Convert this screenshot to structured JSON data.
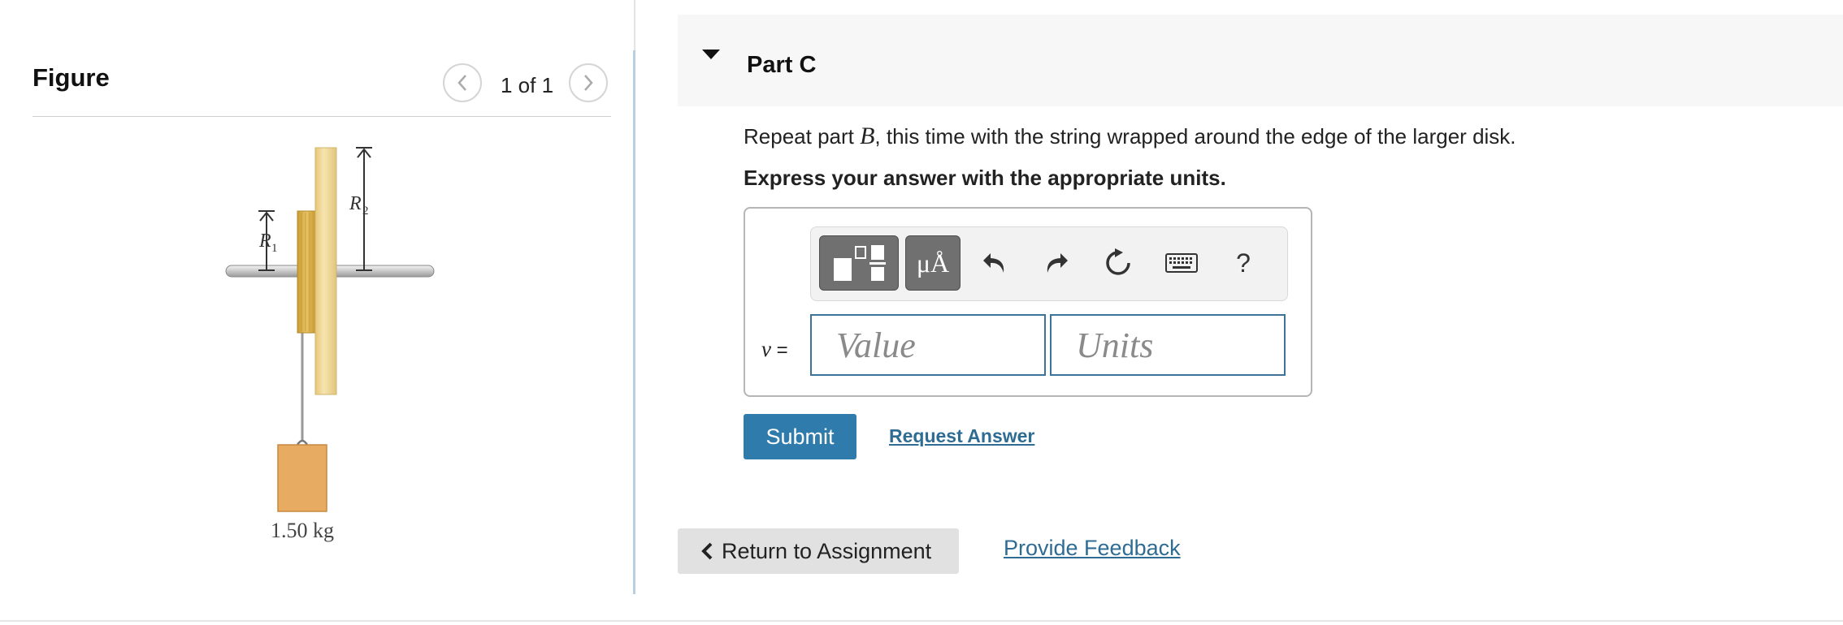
{
  "figure_panel": {
    "title": "Figure",
    "page_count": "1 of 1",
    "labels": {
      "r1": "R",
      "r1_sub": "1",
      "r2": "R",
      "r2_sub": "2",
      "mass": "1.50 kg"
    }
  },
  "part": {
    "title": "Part C",
    "prompt_before": "Repeat part ",
    "prompt_var": "B",
    "prompt_after": ", this time with the string wrapped around the edge of the larger disk.",
    "instruction": "Express your answer with the appropriate units."
  },
  "answer": {
    "variable": "v",
    "equals": " =",
    "value_placeholder": "Value",
    "units_placeholder": "Units",
    "toolbar": {
      "templates_icon": "templates-icon",
      "units_label": "μÅ",
      "undo_icon": "undo-icon",
      "redo_icon": "redo-icon",
      "reset_icon": "reset-icon",
      "keyboard_icon": "keyboard-icon",
      "help_label": "?"
    }
  },
  "actions": {
    "submit": "Submit",
    "request_answer": "Request Answer",
    "return": "Return to Assignment",
    "feedback": "Provide Feedback"
  },
  "colors": {
    "primary": "#2f7bab",
    "link": "#2f6c93",
    "disk": "#f2dca0",
    "small_disk": "#e3bd59",
    "block": "#e8ab62"
  }
}
